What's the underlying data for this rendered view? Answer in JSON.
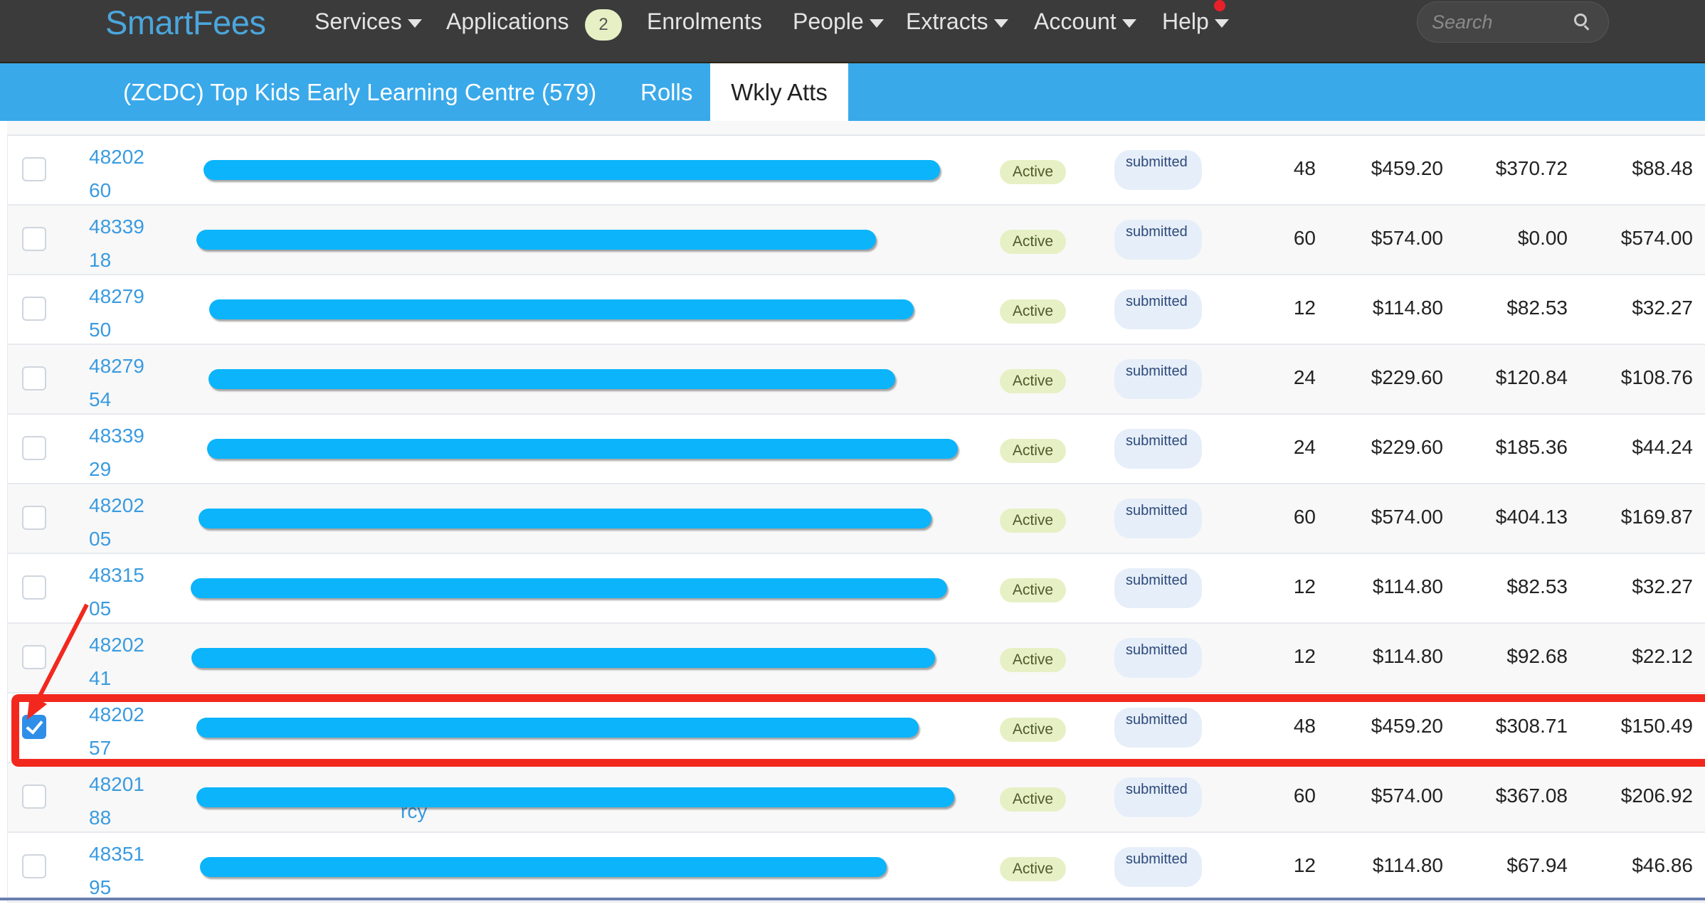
{
  "app": {
    "logo": "SmartFees"
  },
  "nav": {
    "items": [
      {
        "label": "Services",
        "dropdown": true
      },
      {
        "label": "Applications",
        "dropdown": false,
        "badge": "2"
      },
      {
        "label": "Enrolments",
        "dropdown": false
      },
      {
        "label": "People",
        "dropdown": true
      },
      {
        "label": "Extracts",
        "dropdown": true
      },
      {
        "label": "Account",
        "dropdown": true
      },
      {
        "label": "Help",
        "dropdown": true,
        "notification_dot": true
      }
    ],
    "search_placeholder": "Search"
  },
  "subnav": {
    "service_title": "(ZCDC) Top Kids Early Learning Centre (579)",
    "tabs": [
      {
        "label": "Rolls",
        "active": false
      },
      {
        "label": "Wkly Atts",
        "active": true
      }
    ]
  },
  "colors": {
    "accent": "#39a9ea",
    "topbar": "#3b3b3b",
    "highlight": "#f2281e",
    "redaction": "#0bb4fb"
  },
  "rows": [
    {
      "id_line1": "48202",
      "id_line2": "60",
      "status": "Active",
      "submission": "submitted",
      "hours": "48",
      "col1": "$459.20",
      "col2": "$370.72",
      "col3": "$88.48",
      "checked": false
    },
    {
      "id_line1": "48339",
      "id_line2": "18",
      "status": "Active",
      "submission": "submitted",
      "hours": "60",
      "col1": "$574.00",
      "col2": "$0.00",
      "col3": "$574.00",
      "checked": false
    },
    {
      "id_line1": "48279",
      "id_line2": "50",
      "status": "Active",
      "submission": "submitted",
      "hours": "12",
      "col1": "$114.80",
      "col2": "$82.53",
      "col3": "$32.27",
      "checked": false
    },
    {
      "id_line1": "48279",
      "id_line2": "54",
      "status": "Active",
      "submission": "submitted",
      "hours": "24",
      "col1": "$229.60",
      "col2": "$120.84",
      "col3": "$108.76",
      "checked": false
    },
    {
      "id_line1": "48339",
      "id_line2": "29",
      "status": "Active",
      "submission": "submitted",
      "hours": "24",
      "col1": "$229.60",
      "col2": "$185.36",
      "col3": "$44.24",
      "checked": false
    },
    {
      "id_line1": "48202",
      "id_line2": "05",
      "status": "Active",
      "submission": "submitted",
      "hours": "60",
      "col1": "$574.00",
      "col2": "$404.13",
      "col3": "$169.87",
      "checked": false
    },
    {
      "id_line1": "48315",
      "id_line2": "05",
      "status": "Active",
      "submission": "submitted",
      "hours": "12",
      "col1": "$114.80",
      "col2": "$82.53",
      "col3": "$32.27",
      "checked": false
    },
    {
      "id_line1": "48202",
      "id_line2": "41",
      "status": "Active",
      "submission": "submitted",
      "hours": "12",
      "col1": "$114.80",
      "col2": "$92.68",
      "col3": "$22.12",
      "checked": false
    },
    {
      "id_line1": "48202",
      "id_line2": "57",
      "status": "Active",
      "submission": "submitted",
      "hours": "48",
      "col1": "$459.20",
      "col2": "$308.71",
      "col3": "$150.49",
      "checked": true,
      "highlighted": true
    },
    {
      "id_line1": "48201",
      "id_line2": "88",
      "status": "Active",
      "submission": "submitted",
      "hours": "60",
      "col1": "$574.00",
      "col2": "$367.08",
      "col3": "$206.92",
      "checked": false,
      "fragment": "rcy"
    },
    {
      "id_line1": "48351",
      "id_line2": "95",
      "status": "Active",
      "submission": "submitted",
      "hours": "12",
      "col1": "$114.80",
      "col2": "$67.94",
      "col3": "$46.86",
      "checked": false
    }
  ]
}
